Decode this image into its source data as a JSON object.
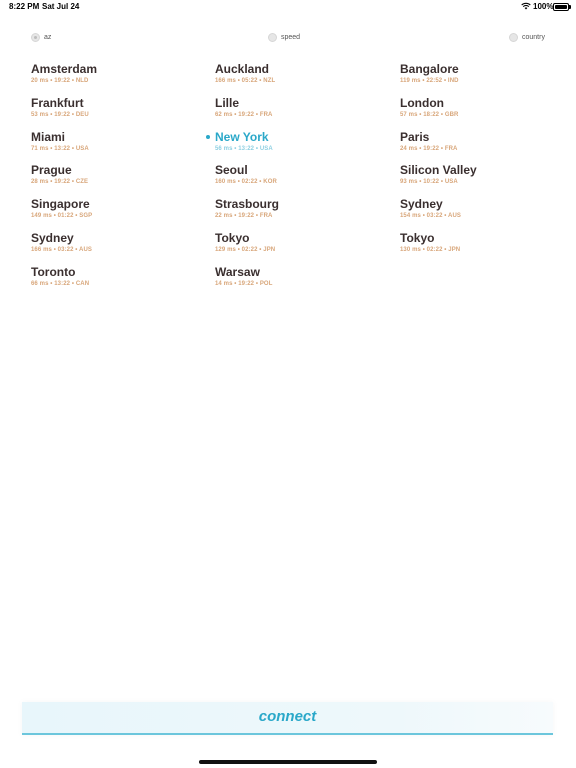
{
  "status_bar": {
    "time": "8:22 PM",
    "date": "Sat Jul 24",
    "battery": "100%",
    "icons": [
      "wifi-icon",
      "battery-icon"
    ]
  },
  "sort": {
    "options": [
      {
        "label": "az",
        "selected": true
      },
      {
        "label": "speed",
        "selected": false
      },
      {
        "label": "country",
        "selected": false
      }
    ]
  },
  "servers": [
    {
      "name": "Amsterdam",
      "meta": "20 ms • 19:22 • NLD"
    },
    {
      "name": "Frankfurt",
      "meta": "53 ms • 19:22 • DEU"
    },
    {
      "name": "Miami",
      "meta": "71 ms • 13:22 • USA"
    },
    {
      "name": "Prague",
      "meta": "28 ms • 19:22 • CZE"
    },
    {
      "name": "Singapore",
      "meta": "149 ms • 01:22 • SGP"
    },
    {
      "name": "Sydney",
      "meta": "166 ms • 03:22 • AUS"
    },
    {
      "name": "Toronto",
      "meta": "66 ms • 13:22 • CAN"
    },
    {
      "name": "Auckland",
      "meta": "166 ms • 05:22 • NZL"
    },
    {
      "name": "Lille",
      "meta": "62 ms • 19:22 • FRA"
    },
    {
      "name": "New York",
      "meta": "56 ms • 13:22 • USA",
      "selected": true
    },
    {
      "name": "Seoul",
      "meta": "160 ms • 02:22 • KOR"
    },
    {
      "name": "Strasbourg",
      "meta": "22 ms • 19:22 • FRA"
    },
    {
      "name": "Tokyo",
      "meta": "129 ms • 02:22 • JPN"
    },
    {
      "name": "Warsaw",
      "meta": "14 ms • 19:22 • POL"
    },
    {
      "name": "Bangalore",
      "meta": "119 ms • 22:52 • IND"
    },
    {
      "name": "London",
      "meta": "57 ms • 18:22 • GBR"
    },
    {
      "name": "Paris",
      "meta": "24 ms • 19:22 • FRA"
    },
    {
      "name": "Silicon Valley",
      "meta": "93 ms • 10:22 • USA"
    },
    {
      "name": "Sydney",
      "meta": "154 ms • 03:22 • AUS"
    },
    {
      "name": "Tokyo",
      "meta": "130 ms • 02:22 • JPN"
    }
  ],
  "colors": {
    "accent": "#2aa8c9",
    "city_name": "#3a2f2f",
    "meta": "#d8a67a"
  },
  "connect": {
    "label": "connect"
  }
}
